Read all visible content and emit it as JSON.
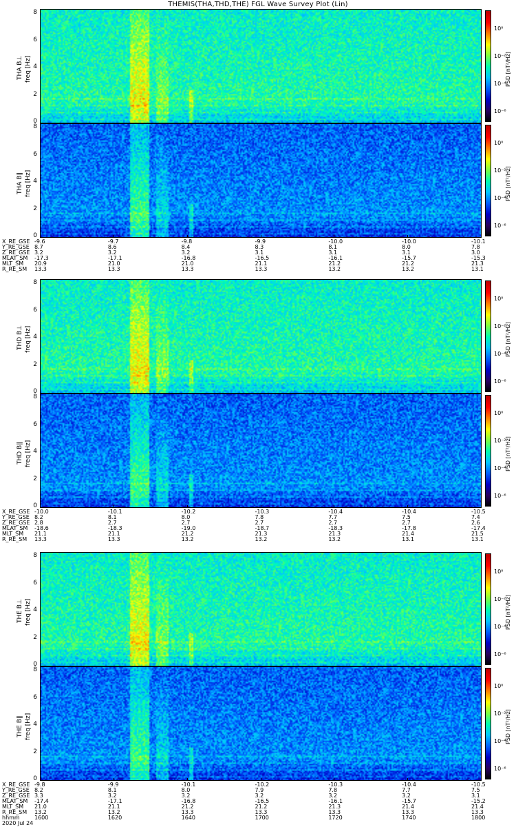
{
  "title": "THEMIS(THA,THD,THE) FGL Wave Survey Plot (Lin)",
  "colors": {
    "background": "#ffffff",
    "text": "#000000"
  },
  "chart_data": {
    "type": "heatmap",
    "colormap": [
      "#000000",
      "#2a0060",
      "#0000c8",
      "#0060ff",
      "#00c8ff",
      "#00ffb0",
      "#80ff40",
      "#ffff00",
      "#ff8000",
      "#ff0000",
      "#c00000"
    ],
    "ylim": [
      0,
      8
    ],
    "yticks": [
      "0",
      "2",
      "4",
      "6",
      "8"
    ],
    "colorbar_ticks": [
      "10⁰",
      "10⁻²",
      "10⁻⁴",
      "10⁻⁶"
    ],
    "colorbar_label": "PSD [nT²/Hz]",
    "probes": [
      {
        "id": "tha",
        "panels": [
          {
            "label": "THA B⊥",
            "ylabel": "freq [Hz]",
            "field": "perp"
          },
          {
            "label": "THA B∥",
            "ylabel": "freq [Hz]",
            "field": "par"
          }
        ],
        "ephemeris": [
          {
            "name": "X_RE_GSE",
            "values": [
              "-9.6",
              "-9.7",
              "-9.8",
              "-9.9",
              "-10.0",
              "-10.0",
              "-10.1"
            ]
          },
          {
            "name": "Y_RE_GSE",
            "values": [
              "8.7",
              "8.6",
              "8.4",
              "8.3",
              "8.1",
              "8.0",
              "7.8"
            ]
          },
          {
            "name": "Z_RE_GSE",
            "values": [
              "3.2",
              "3.2",
              "3.2",
              "3.1",
              "3.1",
              "3.1",
              "3.0"
            ]
          },
          {
            "name": "MLAT_SM",
            "values": [
              "-17.3",
              "-17.1",
              "-16.8",
              "-16.5",
              "-16.1",
              "-15.7",
              "-15.3"
            ]
          },
          {
            "name": "MLT_SM",
            "values": [
              "20.9",
              "21.0",
              "21.0",
              "21.1",
              "21.2",
              "21.2",
              "21.3"
            ]
          },
          {
            "name": "R_RE_SM",
            "values": [
              "13.3",
              "13.3",
              "13.3",
              "13.3",
              "13.2",
              "13.2",
              "13.1"
            ]
          }
        ]
      },
      {
        "id": "thd",
        "panels": [
          {
            "label": "THD B⊥",
            "ylabel": "freq [Hz]",
            "field": "perp"
          },
          {
            "label": "THD B∥",
            "ylabel": "freq [Hz]",
            "field": "par"
          }
        ],
        "ephemeris": [
          {
            "name": "X_RE_GSE",
            "values": [
              "-10.0",
              "-10.1",
              "-10.2",
              "-10.3",
              "-10.4",
              "-10.4",
              "-10.5"
            ]
          },
          {
            "name": "Y_RE_GSE",
            "values": [
              "8.2",
              "8.1",
              "8.0",
              "7.8",
              "7.7",
              "7.5",
              "7.4"
            ]
          },
          {
            "name": "Z_RE_GSE",
            "values": [
              "2.8",
              "2.7",
              "2.7",
              "2.7",
              "2.7",
              "2.7",
              "2.6"
            ]
          },
          {
            "name": "MLAT_SM",
            "values": [
              "-18.6",
              "-18.3",
              "-19.0",
              "-18.7",
              "-18.3",
              "-17.8",
              "-17.4"
            ]
          },
          {
            "name": "MLT_SM",
            "values": [
              "21.1",
              "21.1",
              "21.2",
              "21.3",
              "21.3",
              "21.4",
              "21.5"
            ]
          },
          {
            "name": "R_RE_SM",
            "values": [
              "13.3",
              "13.3",
              "13.2",
              "13.2",
              "13.2",
              "13.1",
              "13.1"
            ]
          }
        ]
      },
      {
        "id": "the",
        "panels": [
          {
            "label": "THE B⊥",
            "ylabel": "freq [Hz]",
            "field": "perp"
          },
          {
            "label": "THE B∥",
            "ylabel": "freq [Hz]",
            "field": "par"
          }
        ],
        "ephemeris": [
          {
            "name": "X_RE_GSE",
            "values": [
              "-9.8",
              "-9.9",
              "-10.1",
              "-10.2",
              "-10.3",
              "-10.4",
              "-10.5"
            ]
          },
          {
            "name": "Y_RE_GSE",
            "values": [
              "8.2",
              "8.1",
              "8.0",
              "7.9",
              "7.8",
              "7.7",
              "7.5"
            ]
          },
          {
            "name": "Z_RE_GSE",
            "values": [
              "3.3",
              "3.2",
              "3.2",
              "3.2",
              "3.2",
              "3.2",
              "3.1"
            ]
          },
          {
            "name": "MLAT_SM",
            "values": [
              "-17.4",
              "-17.1",
              "-16.8",
              "-16.5",
              "-16.1",
              "-15.7",
              "-15.2"
            ]
          },
          {
            "name": "MLT_SM",
            "values": [
              "21.0",
              "21.1",
              "21.2",
              "21.2",
              "21.3",
              "21.4",
              "21.4"
            ]
          },
          {
            "name": "R_RE_SM",
            "values": [
              "13.2",
              "13.2",
              "13.3",
              "13.3",
              "13.3",
              "13.3",
              "13.3"
            ]
          },
          {
            "name": "hhmm",
            "values": [
              "1600",
              "1620",
              "1640",
              "1700",
              "1720",
              "1740",
              "1800"
            ]
          }
        ]
      }
    ],
    "date_label": "2020 Jul 24",
    "time_range": [
      "1600",
      "1800"
    ]
  }
}
